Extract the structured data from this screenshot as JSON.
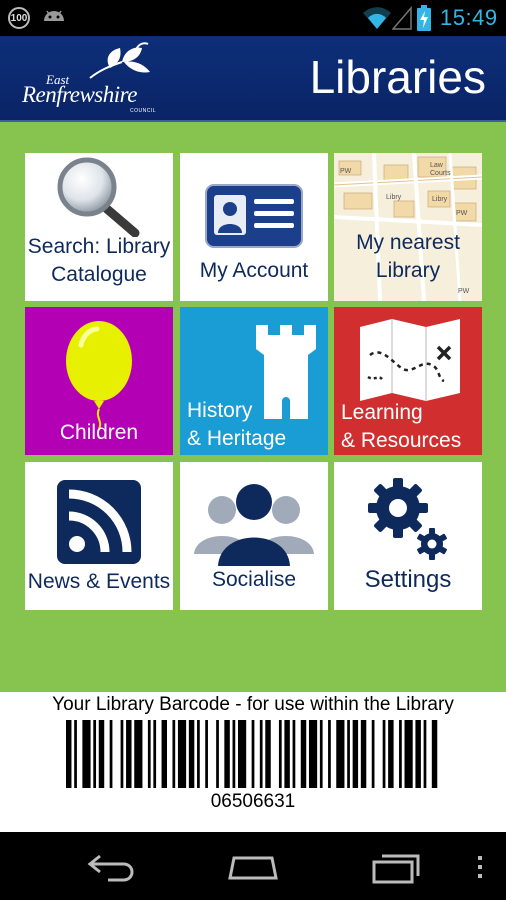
{
  "status_bar": {
    "badge": "100",
    "time": "15:49"
  },
  "header": {
    "logo_east": "East",
    "logo_main": "Renfrewshire",
    "logo_council": "COUNCIL",
    "title": "Libraries"
  },
  "tiles": [
    {
      "label_line1": "Search: Library",
      "label_line2": "Catalogue",
      "bg": "#ffffff"
    },
    {
      "label_line1": "My Account",
      "label_line2": "",
      "bg": "#ffffff"
    },
    {
      "label_line1": "My nearest",
      "label_line2": "Library",
      "bg": "#ffffff"
    },
    {
      "label_line1": "Children",
      "label_line2": "",
      "bg": "#b400b4"
    },
    {
      "label_line1": "History",
      "label_line2": "& Heritage",
      "bg": "#1a9cd4"
    },
    {
      "label_line1": "Learning",
      "label_line2": "& Resources",
      "bg": "#d12f2f"
    },
    {
      "label_line1": "News & Events",
      "label_line2": "",
      "bg": "#ffffff"
    },
    {
      "label_line1": "Socialise",
      "label_line2": "",
      "bg": "#ffffff"
    },
    {
      "label_line1": "Settings",
      "label_line2": "",
      "bg": "#ffffff"
    }
  ],
  "map_labels": [
    "Libry",
    "Law",
    "Courts",
    "PW",
    "Libry",
    "PW",
    "PW"
  ],
  "barcode": {
    "caption": "Your Library Barcode - for use within the Library",
    "number": "06506631"
  },
  "nav_icons": [
    "back-icon",
    "home-icon",
    "recent-apps-icon",
    "menu-icon"
  ],
  "colors": {
    "header_bg": "#0d2f79",
    "main_bg": "#86c34f",
    "status_accent": "#33b5e5",
    "tile_navy": "#0e2a5c"
  }
}
